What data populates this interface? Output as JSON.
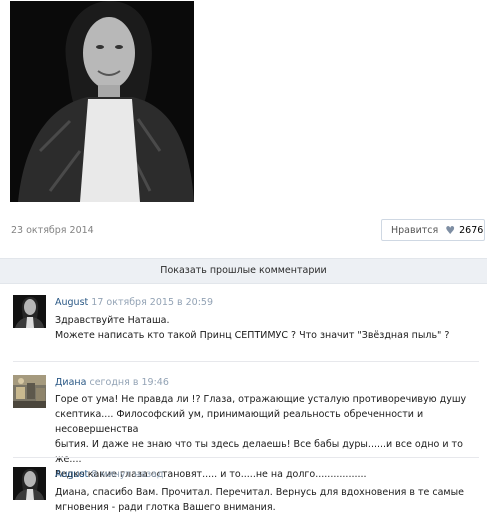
{
  "post": {
    "date": "23 октября 2014",
    "like_label": "Нравится",
    "like_icon": "heart-icon",
    "like_count": "2676"
  },
  "comments_bar": {
    "show_previous_label": "Показать прошлые комментарии"
  },
  "comments": [
    {
      "author": "August",
      "time": "17 октября 2015 в 20:59",
      "lines": [
        "Здравствуйте Наташа.",
        "Можете написать кто такой Принц СЕПТИМУС ? Что значит \"Звёздная пыль\" ?"
      ]
    },
    {
      "author": "Диана",
      "time": "сегодня в 19:46",
      "lines": [
        "Горе от ума! Не правда ли !? Глаза, отражающие усталую противоречивую душу",
        "скептика.... Философский ум, принимающий реальность обреченности и несовершенства",
        "бытия. И даже не знаю что ты здесь делаешь! Все бабы дуры......и все одно и то же....",
        "Редко какие глаза остановят..... и то.....не на долго................."
      ]
    },
    {
      "author": "August",
      "time": "8 минут назад",
      "lines": [
        "Диана, спасибо Вам. Прочитал. Перечитал. Вернусь для вдохновения в те самые",
        "мгновения - ради глотка Вашего внимания."
      ]
    }
  ]
}
